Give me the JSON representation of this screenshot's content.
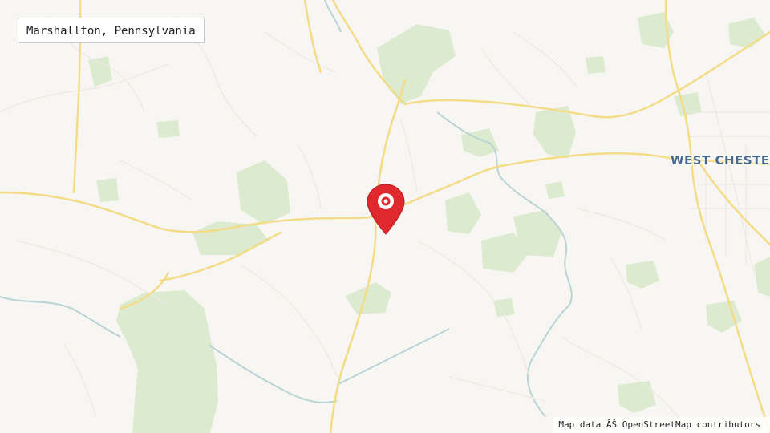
{
  "map": {
    "location_label": "Marshallton, Pennsylvania",
    "city_label": "WEST CHESTER",
    "attribution": "Map data ÂŠ OpenStreetMap contributors",
    "marker_icon": "map-pin-icon",
    "colors": {
      "background": "#f8f6f2",
      "park": "#dcebcf",
      "road_major": "#f4dc86",
      "road_minor": "#ece9e2",
      "water": "#b9d4d4",
      "marker": "#e0292e"
    }
  }
}
